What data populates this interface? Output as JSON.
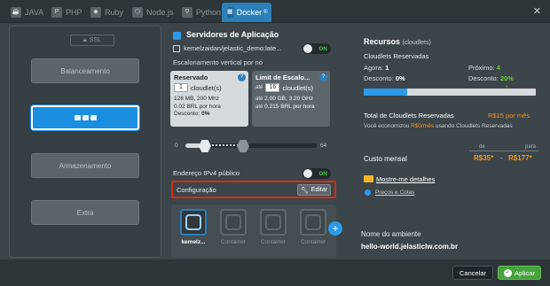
{
  "tabs": [
    {
      "label": "JAVA",
      "icon": "java-icon"
    },
    {
      "label": "PHP",
      "icon": "php-icon"
    },
    {
      "label": "Ruby",
      "icon": "ruby-icon"
    },
    {
      "label": "Node.js",
      "icon": "nodejs-icon"
    },
    {
      "label": "Python",
      "icon": "python-icon"
    },
    {
      "label": "Docker",
      "icon": "docker-icon",
      "badge": "®",
      "active": true
    }
  ],
  "left": {
    "ssl": "SSL",
    "balance": "Balanceamento",
    "storage": "Armazenamento",
    "extra": "Extra"
  },
  "server": {
    "title": "Servidores de Aplicação",
    "node_name": "kemelzaidan/jelastic_demo:late...",
    "node_toggle": "ON",
    "vscale": "Escalonamento vertical por nó",
    "reserved": {
      "title": "Reservado",
      "count": "1",
      "unit": "cloudlet(s)",
      "mem": "128 MB, 200 Mhz",
      "price": "0.02 BRL por hora",
      "discount_label": "Desconto:",
      "discount_value": "0%"
    },
    "limit": {
      "title": "Limit de Escalo...",
      "prefix": "até",
      "count": "16",
      "unit": "cloudlet(s)",
      "mem": "2.00 GB, 3.20 GHz",
      "price": "0.215 BRL por hora"
    },
    "slider_min": "0",
    "slider_max": "64",
    "ipv4": "Endereço IPv4 público",
    "ipv4_toggle": "ON",
    "config": "Configuração",
    "edit": "Editar",
    "containers": [
      "kemelz...",
      "Container",
      "Container",
      "Container"
    ],
    "add": "+"
  },
  "resources": {
    "title": "Recursos",
    "title_unit": "(cloudlets)",
    "reserved_label": "Cloudlets Reservadas",
    "now_label": "Agora:",
    "now_value": "1",
    "disc_label": "Desconto:",
    "disc_value": "0%",
    "next_label": "Próximo:",
    "next_value": "4",
    "next_disc_label": "Desconto:",
    "next_disc_value": "20%",
    "progress": 0.25,
    "total_label": "Total de Cloudlets Reservadas",
    "total_value": "R$15 por mês",
    "saved_prefix": "Você economizou",
    "saved_value": "R$0/mês",
    "saved_suffix": "usando Cloudlets Reservadas",
    "from": "de",
    "to": "para",
    "monthly_label": "Custo mensal",
    "price_from": "R$35*",
    "price_dash": "-",
    "price_to": "R$177*",
    "details": "Mostre-me detalhes",
    "prices": "Preços e Cotas",
    "env_label": "Nome do ambiente",
    "env_value": "hello-world.jelasticlw.com.br"
  },
  "footer": {
    "cancel": "Cancelar",
    "apply": "Aplicar"
  },
  "colors": {
    "accent": "#2c9ae8",
    "highlight": "#d52b1e",
    "price": "#f7941d",
    "ok": "#47a23d"
  }
}
